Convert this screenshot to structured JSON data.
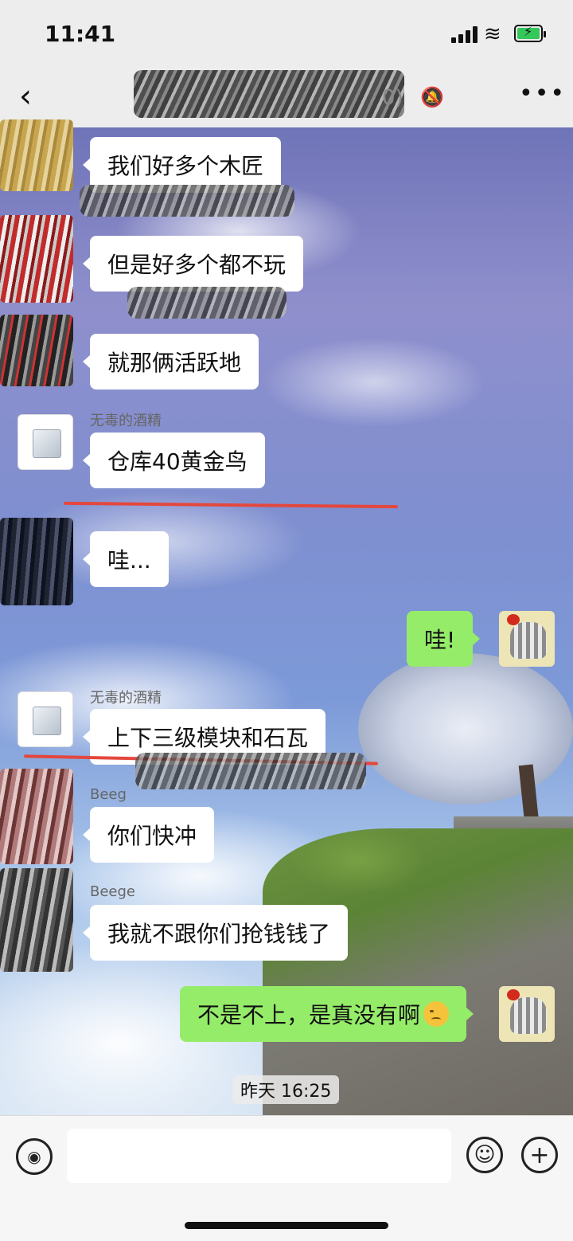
{
  "status_bar": {
    "time": "11:41"
  },
  "header": {
    "title_suffix": "0)",
    "icons": {
      "back": "chevron-left-icon",
      "mute": "bell-slash-icon",
      "more": "ellipsis-icon"
    }
  },
  "messages": [
    {
      "side": "left",
      "text": "我们好多个木匠"
    },
    {
      "side": "left",
      "text": "但是好多个都不玩"
    },
    {
      "side": "left",
      "text": "就那俩活跃地"
    },
    {
      "side": "left",
      "sender": "无毒的酒精",
      "text": "仓库40黄金鸟"
    },
    {
      "side": "left",
      "text": "哇..."
    },
    {
      "side": "right",
      "text": "哇!"
    },
    {
      "side": "left",
      "sender": "无毒的酒精",
      "text": "上下三级模块和石瓦"
    },
    {
      "side": "left",
      "sender": "Beeg",
      "text": "你们快冲"
    },
    {
      "side": "left",
      "sender": "Beege",
      "text": "我就不跟你们抢钱钱了"
    },
    {
      "side": "right",
      "text": "不是不上，是真没有啊",
      "emoji": "sad-face-emoji"
    }
  ],
  "timestamp": "昨天 16:25",
  "input_bar": {
    "placeholder": "",
    "icons": {
      "voice": "voice-icon",
      "emoji": "smile-icon",
      "plus": "plus-icon"
    }
  },
  "colors": {
    "self_bubble": "#95ec69",
    "other_bubble": "#ffffff",
    "annotation": "#e4473d"
  }
}
